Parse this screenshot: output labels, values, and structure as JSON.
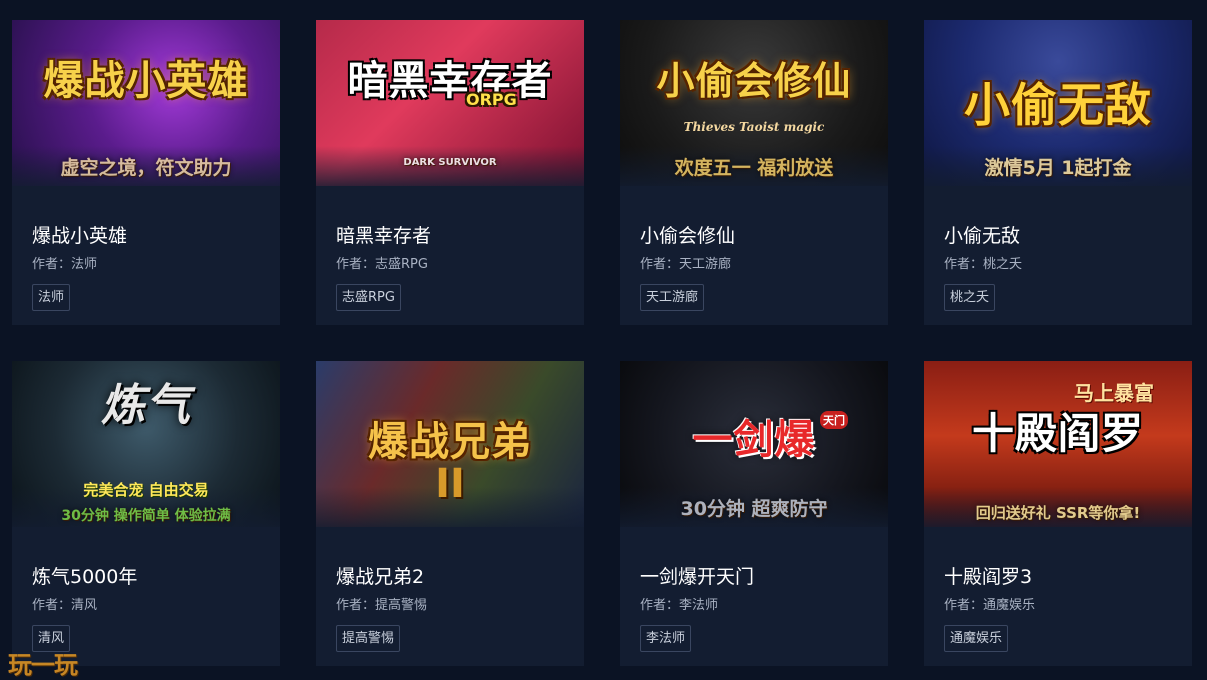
{
  "author_prefix": "作者：",
  "watermark": "玩一玩",
  "games": [
    {
      "name": "爆战小英雄",
      "author": "法师",
      "tag": "法师",
      "cover_title": "爆战小英雄",
      "cover_sub": "虚空之境，符文助力"
    },
    {
      "name": "暗黑幸存者",
      "author": "志盛RPG",
      "tag": "志盛RPG",
      "cover_title": "暗黑幸存者",
      "cover_badge": "ORPG",
      "cover_sub": "DARK SURVIVOR"
    },
    {
      "name": "小偷会修仙",
      "author": "天工游廊",
      "tag": "天工游廊",
      "cover_title": "小偷会修仙",
      "cover_badge": "Thieves Taoist magic",
      "cover_sub": "欢度五一 福利放送"
    },
    {
      "name": "小偷无敌",
      "author": "桃之夭",
      "tag": "桃之夭",
      "cover_title": "小偷无敌",
      "cover_sub": "激情5月  1起打金"
    },
    {
      "name": "炼气5000年",
      "author": "清风",
      "tag": "清风",
      "cover_title": "炼气",
      "cover_badge": "完美合宠  自由交易",
      "cover_sub": "30分钟 操作简单 体验拉满"
    },
    {
      "name": "爆战兄弟2",
      "author": "提高警惕",
      "tag": "提高警惕",
      "cover_title": "爆战兄弟",
      "cover_badge": "II"
    },
    {
      "name": "一剑爆开天门",
      "author": "李法师",
      "tag": "李法师",
      "cover_title": "一剑爆",
      "cover_badge": "天门",
      "cover_sub": "30分钟 超爽防守"
    },
    {
      "name": "十殿阎罗3",
      "author": "通魔娱乐",
      "tag": "通魔娱乐",
      "cover_title": "十殿阎罗",
      "cover_badge": "马上暴富",
      "cover_sub": "回归送好礼 SSR等你拿!"
    }
  ],
  "colors": {
    "page_bg": "#0b1324",
    "card_bg": "#131d31",
    "title_text": "#ffffff",
    "meta_text": "#a9b2c3",
    "tag_border": "#3a4660",
    "watermark": "#e79a24"
  }
}
